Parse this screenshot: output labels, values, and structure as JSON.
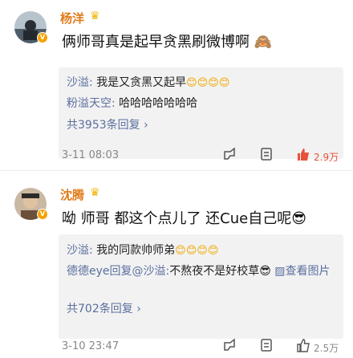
{
  "comments": [
    {
      "user": "杨洋",
      "content": "俩师哥真是起早贪黑刷微博啊 🙈",
      "replies": [
        {
          "user": "沙溢",
          "text": "我是又贪黑又起早",
          "emoji": "😊😊😊😊"
        },
        {
          "user": "粉溢天空",
          "text": "哈哈哈哈哈哈哈",
          "emoji": ""
        }
      ],
      "more_replies": "共3953条回复",
      "time": "3-11 08:03",
      "likes": "2.9万"
    },
    {
      "user": "沈腾",
      "content": "呦 师哥 都这个点儿了 还Cue自己呢😎",
      "replies": [
        {
          "user": "沙溢",
          "text": "我的同款帅师弟",
          "emoji": "😊😊😊😊"
        },
        {
          "user": "德德eye回复@沙溢",
          "text": "不熬夜不是好校草😎",
          "link": "查看图片"
        }
      ],
      "more_replies": "共702条回复",
      "time": "3-10 23:47",
      "likes": "2.5万"
    }
  ],
  "colors": {
    "name": "#e07b1a",
    "reply_user": "#5b6f9e",
    "likes_active": "#e8513a"
  }
}
